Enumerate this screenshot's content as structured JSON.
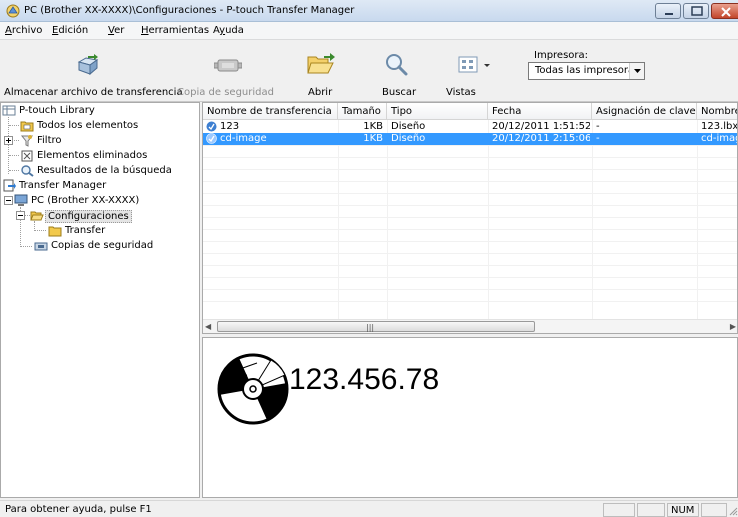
{
  "window": {
    "title": "PC (Brother XX-XXXX)\\Configuraciones - P-touch Transfer Manager"
  },
  "menu": [
    {
      "label": "Archivo",
      "accel": "A",
      "rest": "rchivo"
    },
    {
      "label": "Edición",
      "accel": "E",
      "rest": "dición"
    },
    {
      "label": "Ver",
      "accel": "V",
      "rest": "er"
    },
    {
      "label": "Herramientas",
      "accel": "H",
      "rest": "erramientas"
    },
    {
      "label": "Ayuda",
      "accel": "y",
      "pre": "A",
      "rest": "uda"
    }
  ],
  "toolbar": {
    "save_transfer": "Almacenar archivo de transferencia",
    "backup": "Copia de seguridad",
    "open": "Abrir",
    "search": "Buscar",
    "views": "Vistas",
    "printer_label": "Impresora:",
    "printer_value": "Todas las impresoras"
  },
  "tree": {
    "library": "P-touch Library",
    "all_items": "Todos los elementos",
    "filter": "Filtro",
    "deleted": "Elementos eliminados",
    "search_results": "Resultados de la búsqueda",
    "transfer_manager": "Transfer Manager",
    "pc": "PC (Brother XX-XXXX)",
    "configs": "Configuraciones",
    "transfer": "Transfer",
    "backups": "Copias de seguridad"
  },
  "list": {
    "columns": [
      "Nombre de transferencia",
      "Tamaño",
      "Tipo",
      "Fecha",
      "Asignación de clave",
      "Nombre"
    ],
    "rows": [
      {
        "name": "123",
        "size": "1KB",
        "type": "Diseño",
        "date": "20/12/2011 1:51:52",
        "key": "-",
        "file": "123.lbx",
        "selected": false
      },
      {
        "name": "cd-image",
        "size": "1KB",
        "type": "Diseño",
        "date": "20/12/2011 2:15:06",
        "key": "-",
        "file": "cd-imag",
        "selected": true
      }
    ]
  },
  "preview": {
    "text": "123.456.78"
  },
  "status": {
    "help": "Para obtener ayuda, pulse F1",
    "num": "NUM"
  },
  "colors": {
    "selection": "#3399ff",
    "title_gradient_top": "#dfe9f5",
    "close_button": "#c2452a"
  }
}
